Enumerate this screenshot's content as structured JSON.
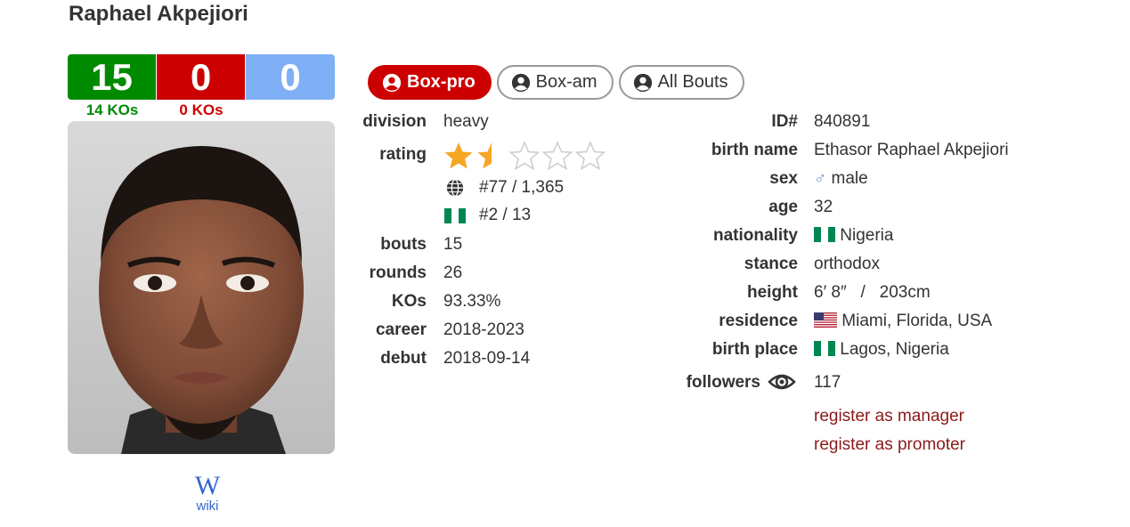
{
  "boxer": {
    "name": "Raphael Akpejiori"
  },
  "record": {
    "wins": "15",
    "losses": "0",
    "draws": "0",
    "wins_kos": "14 KOs",
    "losses_kos": "0 KOs",
    "colors": {
      "win": "#008a00",
      "loss": "#cc0000",
      "draw": "#7fb0f5"
    }
  },
  "wiki": {
    "logo": "W",
    "label": "wiki"
  },
  "tabs": [
    {
      "label": "Box-pro",
      "active": true
    },
    {
      "label": "Box-am",
      "active": false
    },
    {
      "label": "All Bouts",
      "active": false
    }
  ],
  "profile_left": {
    "division_label": "division",
    "division": "heavy",
    "rating_label": "rating",
    "rating_stars": 1.5,
    "rating_max": 5,
    "world_rank": "#77 / 1,365",
    "country_rank": "#2 / 13",
    "bouts_label": "bouts",
    "bouts": "15",
    "rounds_label": "rounds",
    "rounds": "26",
    "kos_label": "KOs",
    "kos": "93.33%",
    "career_label": "career",
    "career": "2018-2023",
    "debut_label": "debut",
    "debut": "2018-09-14"
  },
  "profile_right": {
    "id_label": "ID#",
    "id": "840891",
    "birth_name_label": "birth name",
    "birth_name": "Ethasor Raphael Akpejiori",
    "sex_label": "sex",
    "sex_icon": "male-symbol-icon",
    "sex": "male",
    "age_label": "age",
    "age": "32",
    "nationality_label": "nationality",
    "nationality": "Nigeria",
    "stance_label": "stance",
    "stance": "orthodox",
    "height_label": "height",
    "height": "6′ 8″   /   203cm",
    "residence_label": "residence",
    "residence": "Miami, Florida, USA",
    "birth_place_label": "birth place",
    "birth_place": "Lagos, Nigeria",
    "followers_label": "followers",
    "followers": "117"
  },
  "links": {
    "register_manager": "register as manager",
    "register_promoter": "register as promoter"
  },
  "colors": {
    "star": "#f5a623",
    "star_empty": "#cccccc",
    "tab_active": "#cc0000",
    "link": "#8b1a1a",
    "male": "#6b9bd8"
  }
}
